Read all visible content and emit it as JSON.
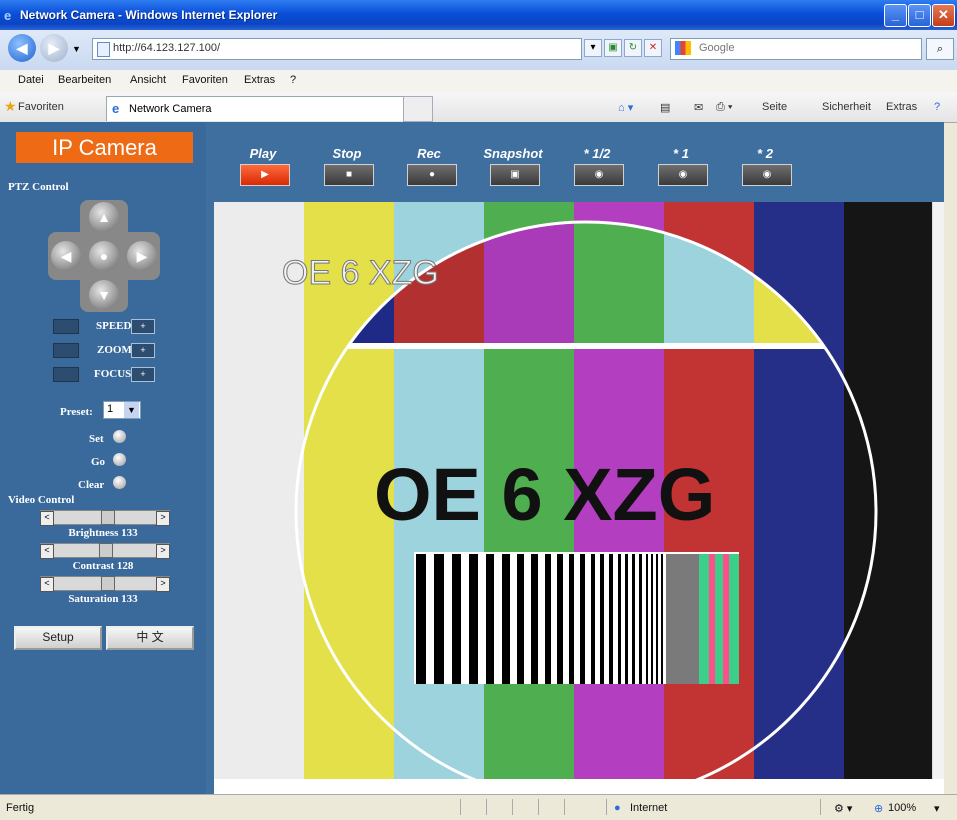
{
  "window": {
    "title": "Network Camera - Windows Internet Explorer",
    "controls": [
      "_",
      "□",
      "✕"
    ]
  },
  "address": {
    "url": "http://64.123.127.100/",
    "search_placeholder": "Google"
  },
  "menu": [
    "Datei",
    "Bearbeiten",
    "Ansicht",
    "Favoriten",
    "Extras",
    "?"
  ],
  "favbar": {
    "favorites": "Favoriten",
    "tab_title": "Network Camera",
    "page": "Seite",
    "safety": "Sicherheit",
    "tools": "Extras"
  },
  "sidebar": {
    "brand": "IP Camera",
    "ptz_title": "PTZ Control",
    "speed": "SPEED",
    "zoom": "ZOOM",
    "focus": "FOCUS",
    "preset_label": "Preset:",
    "preset_value": "1",
    "set": "Set",
    "go": "Go",
    "clear": "Clear",
    "video_title": "Video Control",
    "brightness": "Brightness 133",
    "contrast": "Contrast 128",
    "saturation": "Saturation 133",
    "brightness_level": 133,
    "contrast_level": 128,
    "saturation_level": 133,
    "setup": "Setup",
    "lang": "中 文"
  },
  "toolbar": {
    "play": "Play",
    "stop": "Stop",
    "rec": "Rec",
    "snapshot": "Snapshot",
    "half": "* 1/2",
    "one": "* 1",
    "two": "* 2"
  },
  "video": {
    "overlay_small": "OE 6 XZG",
    "overlay_big": "OE 6 XZG"
  },
  "statusbar": {
    "left": "Fertig",
    "zone": "Internet",
    "zoom": "100%"
  }
}
